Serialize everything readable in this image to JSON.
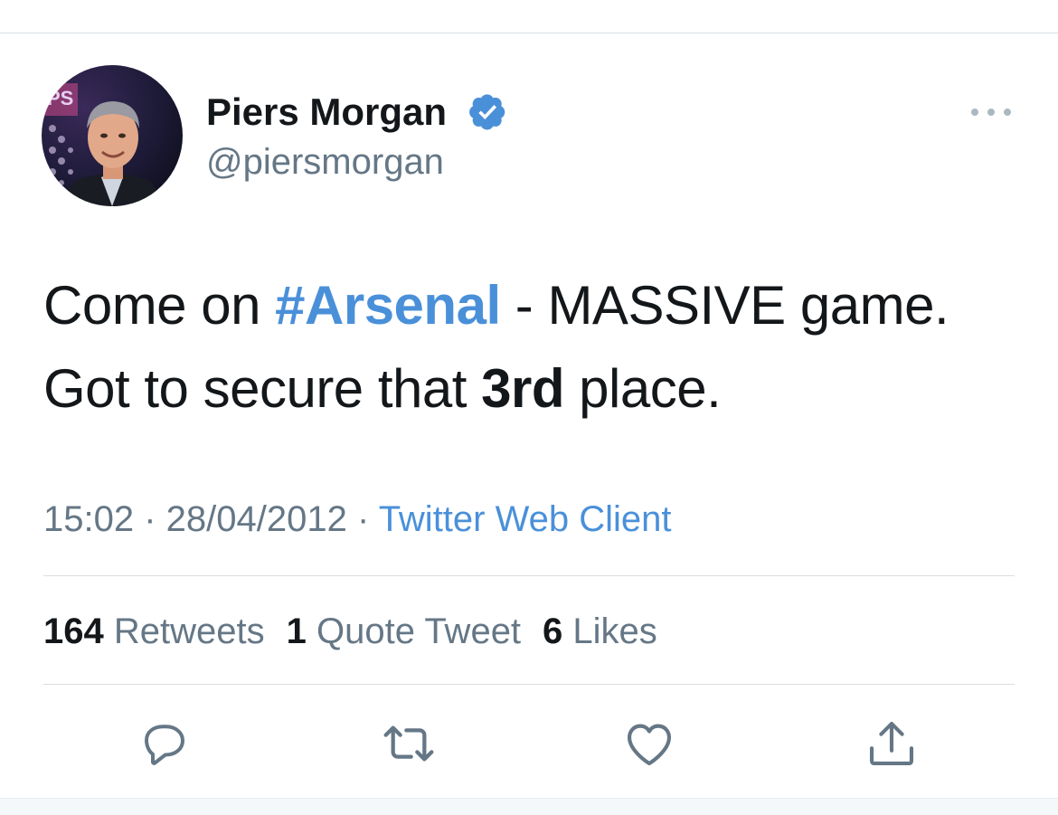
{
  "tweet": {
    "author": {
      "display_name": "Piers Morgan",
      "handle": "@piersmorgan",
      "verified": true,
      "avatar_icon": "profile-photo"
    },
    "text": {
      "part1": "Come on ",
      "hashtag": "#Arsenal",
      "part2": " - MASSIVE game.",
      "part3": "Got to secure that ",
      "bold": "3rd",
      "part4": " place."
    },
    "meta": {
      "time": "15:02",
      "separator": " · ",
      "date": "28/04/2012",
      "client": "Twitter Web Client"
    },
    "stats": {
      "retweets_count": "164",
      "retweets_label": " Retweets",
      "quotes_count": "1",
      "quotes_label": " Quote Tweet",
      "likes_count": "6",
      "likes_label": " Likes"
    },
    "actions": [
      {
        "name": "reply",
        "icon": "reply-icon"
      },
      {
        "name": "retweet",
        "icon": "retweet-icon"
      },
      {
        "name": "like",
        "icon": "heart-icon"
      },
      {
        "name": "share",
        "icon": "share-icon"
      }
    ]
  },
  "colors": {
    "link": "#4a90d9",
    "muted": "#657786",
    "text": "#14171a",
    "verified": "#4a90d9"
  }
}
